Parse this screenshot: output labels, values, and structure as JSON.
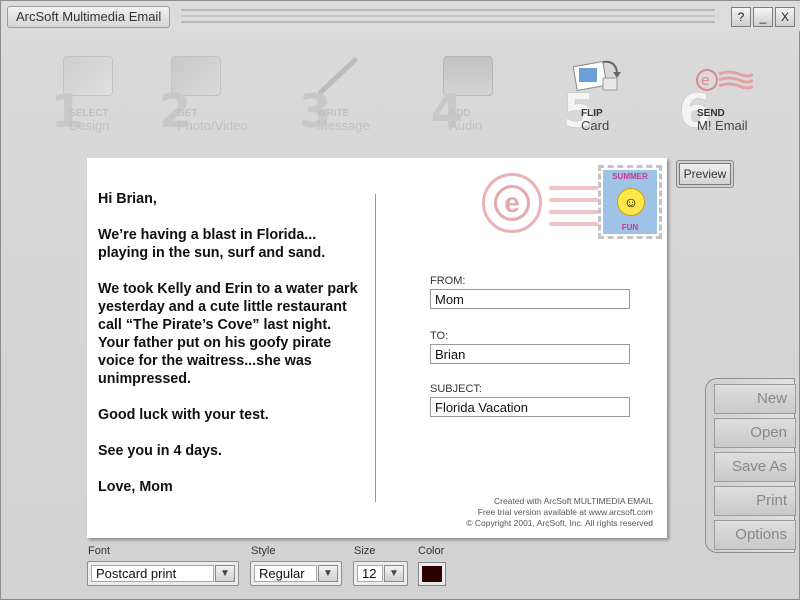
{
  "window": {
    "title": "ArcSoft Multimedia Email",
    "buttons": [
      "?",
      "_",
      "X"
    ]
  },
  "steps": [
    {
      "num": "1",
      "line1": "SELECT",
      "line2": "Design",
      "active": false,
      "icon": "design-icon"
    },
    {
      "num": "2",
      "line1": "GET",
      "line2": "Photo/Video",
      "active": false,
      "icon": "photo-video-icon"
    },
    {
      "num": "3",
      "line1": "WRITE",
      "line2": "Message",
      "active": false,
      "icon": "pen-icon"
    },
    {
      "num": "4",
      "line1": "ADD",
      "line2": "Audio",
      "active": false,
      "icon": "cassette-icon"
    },
    {
      "num": "5",
      "line1": "FLIP",
      "line2": "Card",
      "active": true,
      "icon": "flip-card-icon"
    },
    {
      "num": "6",
      "line1": "SEND",
      "line2": "M! Email",
      "active": true,
      "icon": "email-postmark-icon"
    }
  ],
  "postcard": {
    "message": [
      "Hi Brian,",
      "We’re having a blast in Florida...\nplaying in the sun, surf and sand.",
      "We took Kelly and Erin to a water park\nyesterday and a cute little restaurant\ncall “The Pirate’s Cove” last night.\nYour father put on his goofy pirate\nvoice for the waitress...she was\nunimpressed.",
      "Good luck with your test.",
      "See you in 4 days.",
      "Love, Mom"
    ],
    "from_label": "FROM:",
    "from_value": "Mom",
    "to_label": "TO:",
    "to_value": "Brian",
    "subject_label": "SUBJECT:",
    "subject_value": "Florida Vacation",
    "stamp_top": "SUMMER",
    "stamp_bottom": "FUN",
    "postmark_letter": "e",
    "credits": [
      "Created with ArcSoft MULTIMEDIA EMAIL",
      "Free trial version available at www.arcsoft.com",
      "© Copyright 2001, ArcSoft, Inc. All rights reserved"
    ]
  },
  "preview_label": "Preview",
  "actions": [
    "New",
    "Open",
    "Save As",
    "Print",
    "Options"
  ],
  "controls": {
    "font_label": "Font",
    "font_value": "Postcard print",
    "style_label": "Style",
    "style_value": "Regular",
    "size_label": "Size",
    "size_value": "12",
    "color_label": "Color",
    "color_value": "#2a0000"
  },
  "colors": {
    "background": "#d6d6d6",
    "postmark": "#e6a8a8",
    "stamp_bg": "#9fc3e6"
  }
}
